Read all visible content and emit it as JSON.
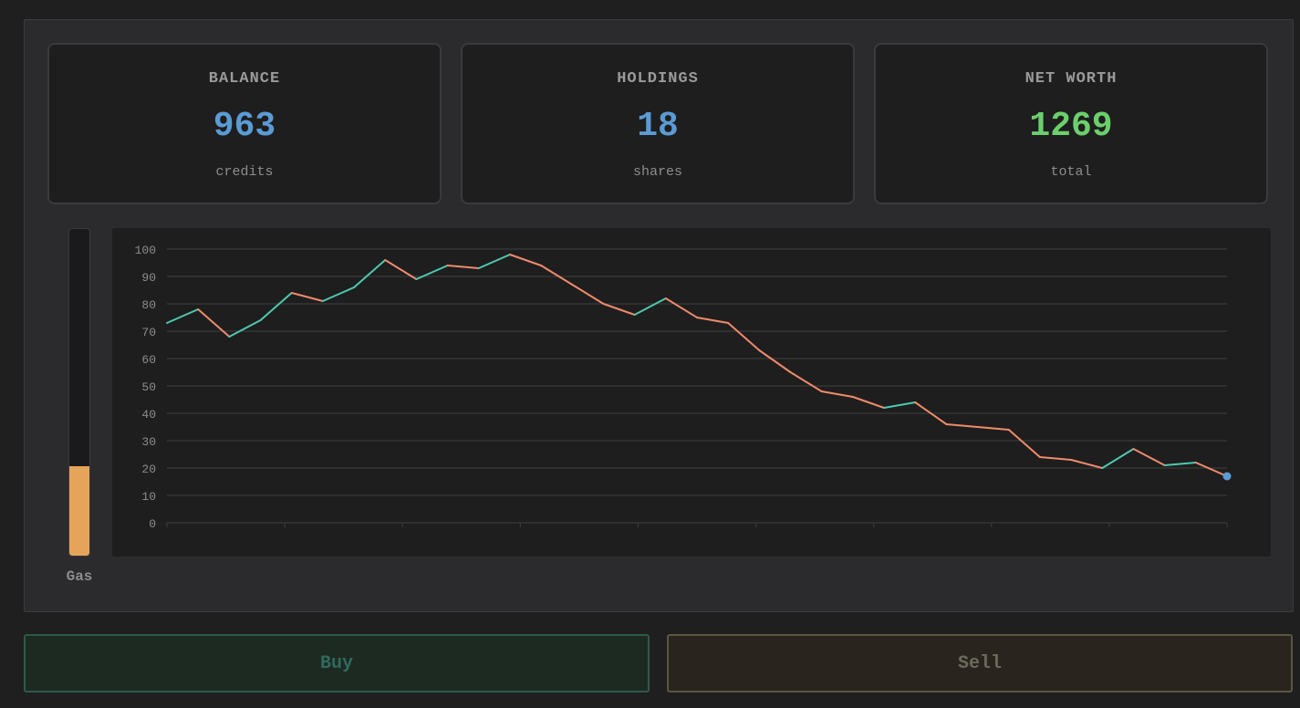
{
  "stats": [
    {
      "label": "BALANCE",
      "value": "963",
      "unit": "credits",
      "color": "#5b9bd5"
    },
    {
      "label": "HOLDINGS",
      "value": "18",
      "unit": "shares",
      "color": "#5b9bd5"
    },
    {
      "label": "NET WORTH",
      "value": "1269",
      "unit": "total",
      "color": "#6ccf6c"
    }
  ],
  "gas": {
    "label": "Gas",
    "level": 0.275,
    "color": "#e5a45a"
  },
  "colors": {
    "up": "#4ec9b0",
    "down": "#f08a6c",
    "marker": "#5b9bd5",
    "grid": "#3a3a3c",
    "tick": "#8d8d8d"
  },
  "chart_data": {
    "type": "line",
    "ylim": [
      0,
      100
    ],
    "yticks": [
      0,
      10,
      20,
      30,
      40,
      50,
      60,
      70,
      80,
      90,
      100
    ],
    "grid": true,
    "series": [
      {
        "values": [
          73,
          78,
          68,
          74,
          84,
          81,
          86,
          96,
          89,
          94,
          93,
          98,
          94,
          87,
          80,
          76,
          82,
          75,
          73,
          63,
          55,
          48,
          46,
          42,
          44,
          36,
          35,
          34,
          24,
          23,
          20,
          27,
          21,
          22,
          17
        ]
      }
    ]
  },
  "actions": {
    "buy_label": "Buy",
    "sell_label": "Sell"
  }
}
